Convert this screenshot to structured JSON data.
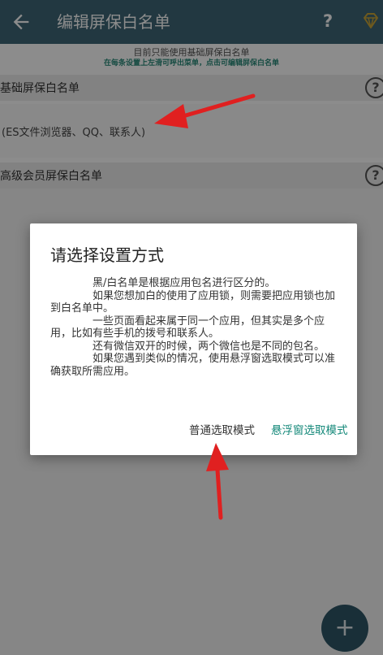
{
  "appbar": {
    "title": "编辑屏保白名单",
    "help_label": "?"
  },
  "notice": {
    "line1": "目前只能使用基础屏保白名单",
    "line2": "在每条设置上左滑可呼出菜单，点击可编辑屏保白名单"
  },
  "sections": {
    "basic": {
      "label": "基础屏保白名单",
      "help": "?"
    },
    "whitelist_apps": "(ES文件浏览器、QQ、联系人)",
    "premium": {
      "label": "高级会员屏保白名单",
      "help": "?"
    }
  },
  "dialog": {
    "title": "请选择设置方式",
    "paragraphs": [
      "黑/白名单是根据应用包名进行区分的。",
      "如果您想加白的使用了应用锁，则需要把应用锁也加到白名单中。",
      "一些页面看起来属于同一个应用，但其实是多个应用，比如有些手机的拨号和联系人。",
      "还有微信双开的时候，两个微信也是不同的包名。",
      "如果您遇到类似的情况，使用悬浮窗选取模式可以准确获取所需应用。"
    ],
    "button_normal": "普通选取模式",
    "button_float": "悬浮窗选取模式"
  },
  "fab": {
    "label": "+"
  },
  "colors": {
    "appbar": "#3f6777",
    "accent": "#15897a",
    "annotation_arrow": "#e02020",
    "fab": "#2f5767"
  },
  "icons": {
    "back": "arrow-left-icon",
    "vip": "diamond-icon",
    "help": "help-circle-icon",
    "add": "plus-icon"
  }
}
